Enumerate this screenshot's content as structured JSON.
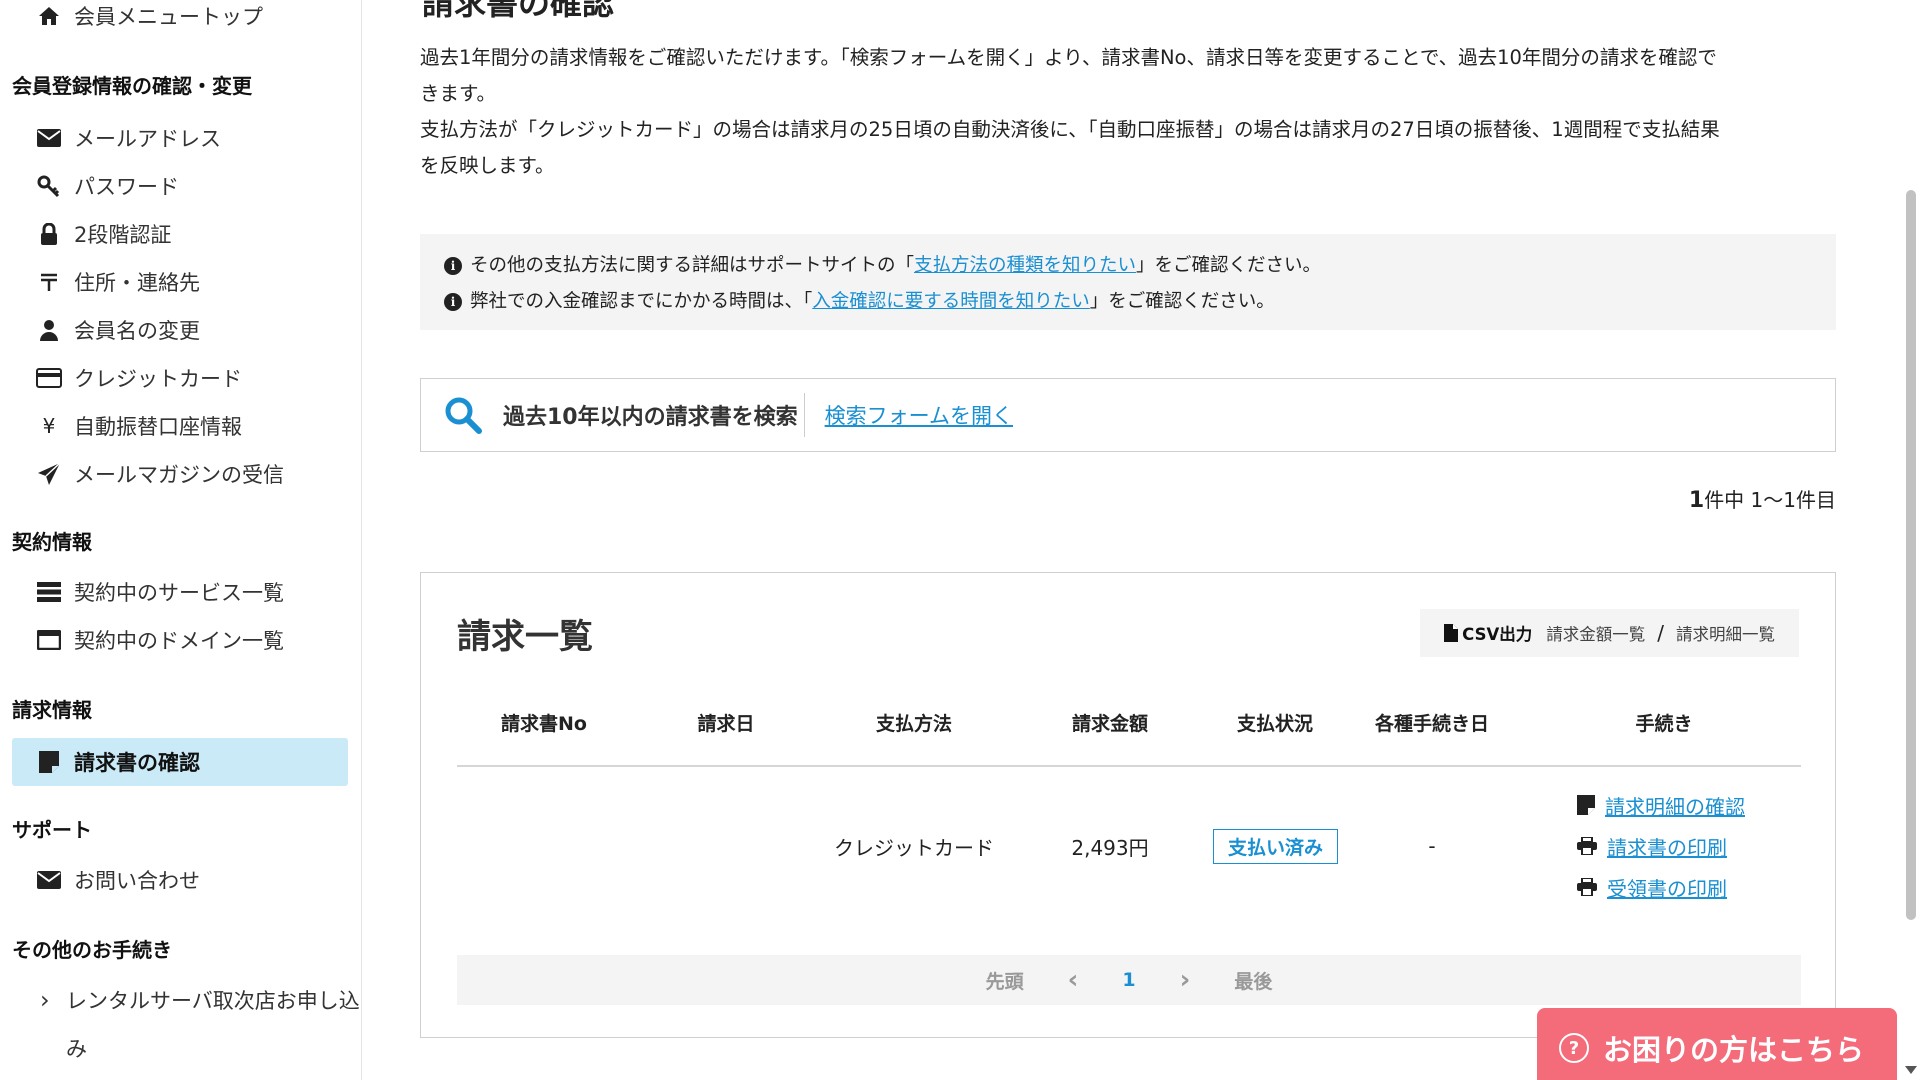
{
  "sidebar": {
    "top_item": "会員メニュートップ",
    "sections": {
      "member": "会員登録情報の確認・変更",
      "contract": "契約情報",
      "billing": "請求情報",
      "support": "サポート",
      "other": "その他のお手続き"
    },
    "member_items": [
      "メールアドレス",
      "パスワード",
      "2段階認証",
      "住所・連絡先",
      "会員名の変更",
      "クレジットカード",
      "自動振替口座情報",
      "メールマガジンの受信"
    ],
    "contract_items": [
      "契約中のサービス一覧",
      "契約中のドメイン一覧"
    ],
    "billing_items": [
      "請求書の確認"
    ],
    "support_items": [
      "お問い合わせ"
    ],
    "other_items": [
      "レンタルサーバ取次店お申し込",
      "み"
    ],
    "yen_glyph": "¥",
    "chevron_glyph": "›"
  },
  "main": {
    "title": "請求書の確認",
    "intro": [
      "過去1年間分の請求情報をご確認いただけます。「検索フォームを開く」より、請求書No、請求日等を変更することで、過去10年間分の請求を確認で",
      "きます。",
      "支払方法が「クレジットカード」の場合は請求月の25日頃の自動決済後に、「自動口座振替」の場合は請求月の27日頃の振替後、1週間程で支払結果",
      "を反映します。"
    ],
    "notice": {
      "line1_before": "その他の支払方法に関する詳細はサポートサイトの「",
      "line1_link": "支払方法の種類を知りたい",
      "line1_after": "」をご確認ください。",
      "line2_before": "弊社での入金確認までにかかる時間は、「",
      "line2_link": "入金確認に要する時間を知りたい",
      "line2_after": "」をご確認ください。"
    },
    "search": {
      "label": "過去10年以内の請求書を検索",
      "link": "検索フォームを開く"
    },
    "count": {
      "total": "1",
      "suffix": "件中 1～1件目"
    },
    "table_card": {
      "title": "請求一覧",
      "csv_label": "CSV出力",
      "csv_link1": "請求金額一覧",
      "csv_sep": "/",
      "csv_link2": "請求明細一覧",
      "headers": [
        "請求書No",
        "請求日",
        "支払方法",
        "請求金額",
        "支払状況",
        "各種手続き日",
        "手続き"
      ],
      "rows": [
        {
          "invoice_no": "",
          "date": "",
          "method": "クレジットカード",
          "amount": "2,493円",
          "status": "支払い済み",
          "proc_date": "-",
          "actions": [
            "請求明細の確認",
            "請求書の印刷",
            "受領書の印刷"
          ]
        }
      ],
      "pager": {
        "first": "先頭",
        "prev": "‹",
        "current": "1",
        "next": "›",
        "last": "最後"
      }
    }
  },
  "help_button": {
    "label": "お困りの方はこちら",
    "icon": "?"
  },
  "colors": {
    "accent": "#1a8fd1",
    "active_bg": "#cbeaf8",
    "help_bg": "#f46b7a"
  }
}
